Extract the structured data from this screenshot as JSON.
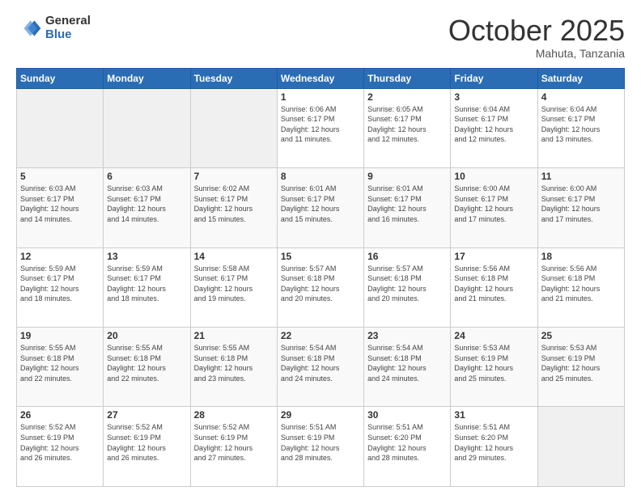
{
  "logo": {
    "general": "General",
    "blue": "Blue"
  },
  "header": {
    "month": "October 2025",
    "location": "Mahuta, Tanzania"
  },
  "weekdays": [
    "Sunday",
    "Monday",
    "Tuesday",
    "Wednesday",
    "Thursday",
    "Friday",
    "Saturday"
  ],
  "weeks": [
    [
      {
        "day": "",
        "info": ""
      },
      {
        "day": "",
        "info": ""
      },
      {
        "day": "",
        "info": ""
      },
      {
        "day": "1",
        "info": "Sunrise: 6:06 AM\nSunset: 6:17 PM\nDaylight: 12 hours\nand 11 minutes."
      },
      {
        "day": "2",
        "info": "Sunrise: 6:05 AM\nSunset: 6:17 PM\nDaylight: 12 hours\nand 12 minutes."
      },
      {
        "day": "3",
        "info": "Sunrise: 6:04 AM\nSunset: 6:17 PM\nDaylight: 12 hours\nand 12 minutes."
      },
      {
        "day": "4",
        "info": "Sunrise: 6:04 AM\nSunset: 6:17 PM\nDaylight: 12 hours\nand 13 minutes."
      }
    ],
    [
      {
        "day": "5",
        "info": "Sunrise: 6:03 AM\nSunset: 6:17 PM\nDaylight: 12 hours\nand 14 minutes."
      },
      {
        "day": "6",
        "info": "Sunrise: 6:03 AM\nSunset: 6:17 PM\nDaylight: 12 hours\nand 14 minutes."
      },
      {
        "day": "7",
        "info": "Sunrise: 6:02 AM\nSunset: 6:17 PM\nDaylight: 12 hours\nand 15 minutes."
      },
      {
        "day": "8",
        "info": "Sunrise: 6:01 AM\nSunset: 6:17 PM\nDaylight: 12 hours\nand 15 minutes."
      },
      {
        "day": "9",
        "info": "Sunrise: 6:01 AM\nSunset: 6:17 PM\nDaylight: 12 hours\nand 16 minutes."
      },
      {
        "day": "10",
        "info": "Sunrise: 6:00 AM\nSunset: 6:17 PM\nDaylight: 12 hours\nand 17 minutes."
      },
      {
        "day": "11",
        "info": "Sunrise: 6:00 AM\nSunset: 6:17 PM\nDaylight: 12 hours\nand 17 minutes."
      }
    ],
    [
      {
        "day": "12",
        "info": "Sunrise: 5:59 AM\nSunset: 6:17 PM\nDaylight: 12 hours\nand 18 minutes."
      },
      {
        "day": "13",
        "info": "Sunrise: 5:59 AM\nSunset: 6:17 PM\nDaylight: 12 hours\nand 18 minutes."
      },
      {
        "day": "14",
        "info": "Sunrise: 5:58 AM\nSunset: 6:17 PM\nDaylight: 12 hours\nand 19 minutes."
      },
      {
        "day": "15",
        "info": "Sunrise: 5:57 AM\nSunset: 6:18 PM\nDaylight: 12 hours\nand 20 minutes."
      },
      {
        "day": "16",
        "info": "Sunrise: 5:57 AM\nSunset: 6:18 PM\nDaylight: 12 hours\nand 20 minutes."
      },
      {
        "day": "17",
        "info": "Sunrise: 5:56 AM\nSunset: 6:18 PM\nDaylight: 12 hours\nand 21 minutes."
      },
      {
        "day": "18",
        "info": "Sunrise: 5:56 AM\nSunset: 6:18 PM\nDaylight: 12 hours\nand 21 minutes."
      }
    ],
    [
      {
        "day": "19",
        "info": "Sunrise: 5:55 AM\nSunset: 6:18 PM\nDaylight: 12 hours\nand 22 minutes."
      },
      {
        "day": "20",
        "info": "Sunrise: 5:55 AM\nSunset: 6:18 PM\nDaylight: 12 hours\nand 22 minutes."
      },
      {
        "day": "21",
        "info": "Sunrise: 5:55 AM\nSunset: 6:18 PM\nDaylight: 12 hours\nand 23 minutes."
      },
      {
        "day": "22",
        "info": "Sunrise: 5:54 AM\nSunset: 6:18 PM\nDaylight: 12 hours\nand 24 minutes."
      },
      {
        "day": "23",
        "info": "Sunrise: 5:54 AM\nSunset: 6:18 PM\nDaylight: 12 hours\nand 24 minutes."
      },
      {
        "day": "24",
        "info": "Sunrise: 5:53 AM\nSunset: 6:19 PM\nDaylight: 12 hours\nand 25 minutes."
      },
      {
        "day": "25",
        "info": "Sunrise: 5:53 AM\nSunset: 6:19 PM\nDaylight: 12 hours\nand 25 minutes."
      }
    ],
    [
      {
        "day": "26",
        "info": "Sunrise: 5:52 AM\nSunset: 6:19 PM\nDaylight: 12 hours\nand 26 minutes."
      },
      {
        "day": "27",
        "info": "Sunrise: 5:52 AM\nSunset: 6:19 PM\nDaylight: 12 hours\nand 26 minutes."
      },
      {
        "day": "28",
        "info": "Sunrise: 5:52 AM\nSunset: 6:19 PM\nDaylight: 12 hours\nand 27 minutes."
      },
      {
        "day": "29",
        "info": "Sunrise: 5:51 AM\nSunset: 6:19 PM\nDaylight: 12 hours\nand 28 minutes."
      },
      {
        "day": "30",
        "info": "Sunrise: 5:51 AM\nSunset: 6:20 PM\nDaylight: 12 hours\nand 28 minutes."
      },
      {
        "day": "31",
        "info": "Sunrise: 5:51 AM\nSunset: 6:20 PM\nDaylight: 12 hours\nand 29 minutes."
      },
      {
        "day": "",
        "info": ""
      }
    ]
  ]
}
